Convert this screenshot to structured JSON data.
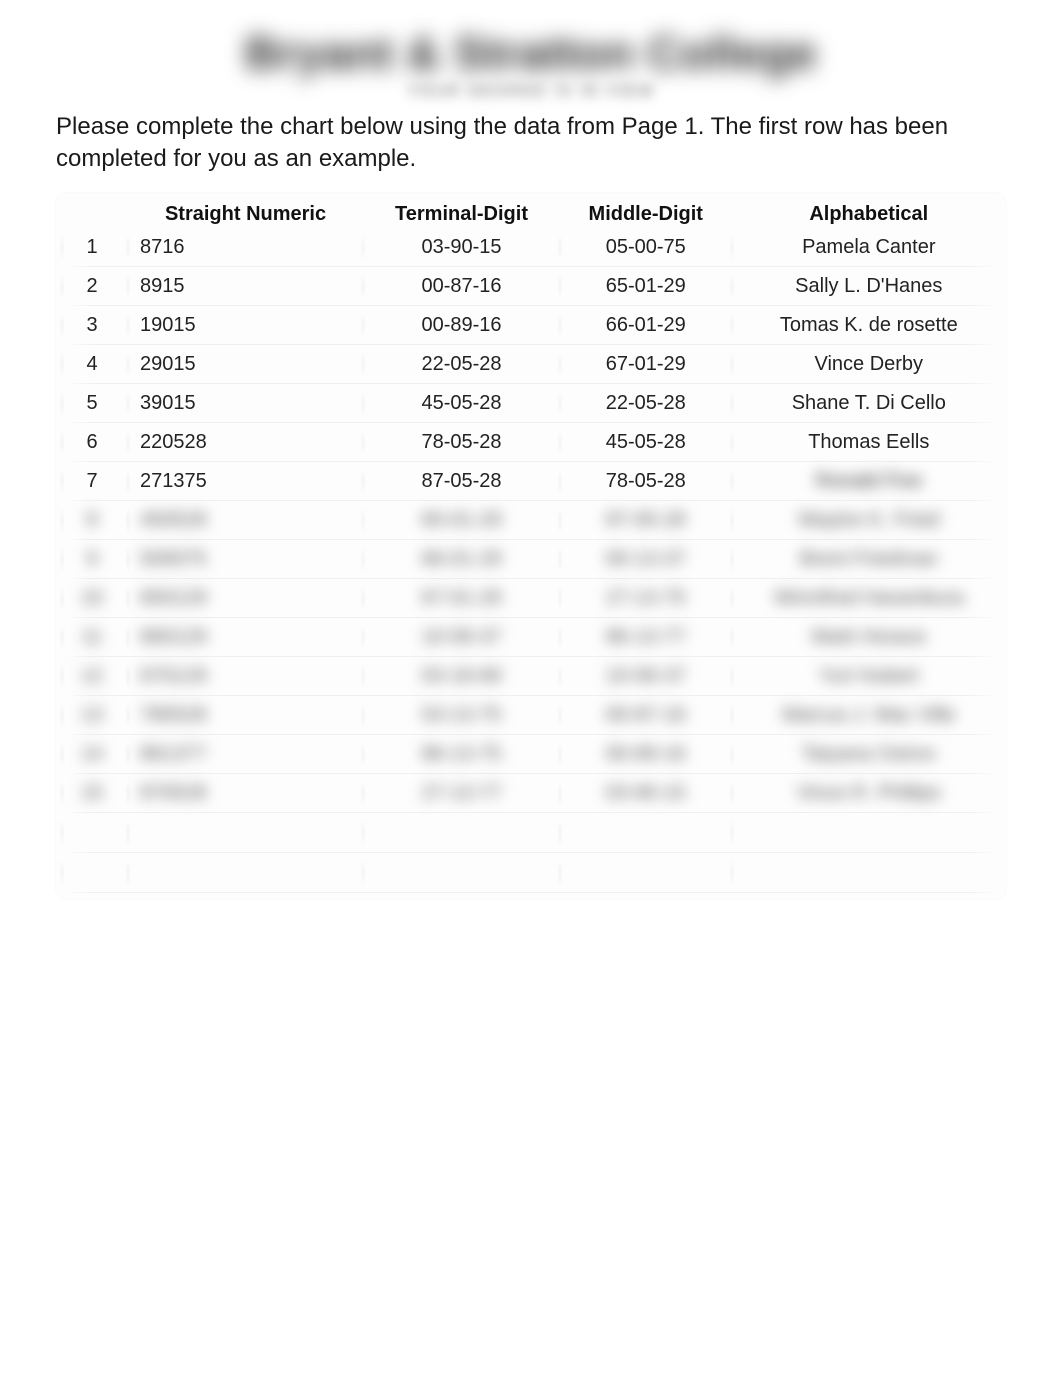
{
  "header": {
    "title": "Bryant & Stratton College",
    "subtitle": "YOUR DEGREE IS IN VIEW"
  },
  "instructions": "Please complete the chart below using the data from Page 1. The first row has been completed for you as an example.",
  "columns": {
    "straight_numeric": "Straight Numeric",
    "terminal_digit": "Terminal-Digit",
    "middle_digit": "Middle-Digit",
    "alphabetical": "Alphabetical"
  },
  "rows": [
    {
      "n": "1",
      "straight_numeric": "8716",
      "terminal_digit": "03-90-15",
      "middle_digit": "05-00-75",
      "alphabetical": "Pamela Canter"
    },
    {
      "n": "2",
      "straight_numeric": "8915",
      "terminal_digit": "00-87-16",
      "middle_digit": "65-01-29",
      "alphabetical": "Sally L. D'Hanes"
    },
    {
      "n": "3",
      "straight_numeric": "19015",
      "terminal_digit": "00-89-16",
      "middle_digit": "66-01-29",
      "alphabetical": "Tomas K. de rosette"
    },
    {
      "n": "4",
      "straight_numeric": "29015",
      "terminal_digit": "22-05-28",
      "middle_digit": "67-01-29",
      "alphabetical": "Vince Derby"
    },
    {
      "n": "5",
      "straight_numeric": "39015",
      "terminal_digit": "45-05-28",
      "middle_digit": "22-05-28",
      "alphabetical": "Shane T. Di Cello"
    },
    {
      "n": "6",
      "straight_numeric": "220528",
      "terminal_digit": "78-05-28",
      "middle_digit": "45-05-28",
      "alphabetical": "Thomas Eells"
    },
    {
      "n": "7",
      "straight_numeric": "271375",
      "terminal_digit": "87-05-28",
      "middle_digit": "78-05-28",
      "alphabetical": ""
    }
  ],
  "obscured_rows": [
    {
      "n": "8",
      "sn": "450528",
      "td": "65-01-29",
      "md": "87-05-28",
      "al": "Waylon K. Fried"
    },
    {
      "n": "9",
      "sn": "500075",
      "td": "66-01-29",
      "md": "00-13-37",
      "al": "Brent Friedman"
    },
    {
      "n": "10",
      "sn": "650129",
      "td": "67-01-29",
      "md": "27-13-75",
      "al": "Winnifred Harambura"
    },
    {
      "n": "11",
      "sn": "660129",
      "td": "10-58-37",
      "md": "86-13-77",
      "al": "Mark Horace"
    },
    {
      "n": "12",
      "sn": "670129",
      "td": "03-18-69",
      "md": "10-58-37",
      "al": "Yuri Hubert"
    },
    {
      "n": "13",
      "sn": "780528",
      "td": "53-13-75",
      "md": "00-87-16",
      "al": "Marcus J. Mac Ville"
    },
    {
      "n": "14",
      "sn": "861377",
      "td": "86-13-75",
      "md": "00-89-16",
      "al": "Tatyana Ostrov"
    },
    {
      "n": "15",
      "sn": "870528",
      "td": "27-13-77",
      "md": "03-90-15",
      "al": "Vince R. Phillips"
    }
  ]
}
